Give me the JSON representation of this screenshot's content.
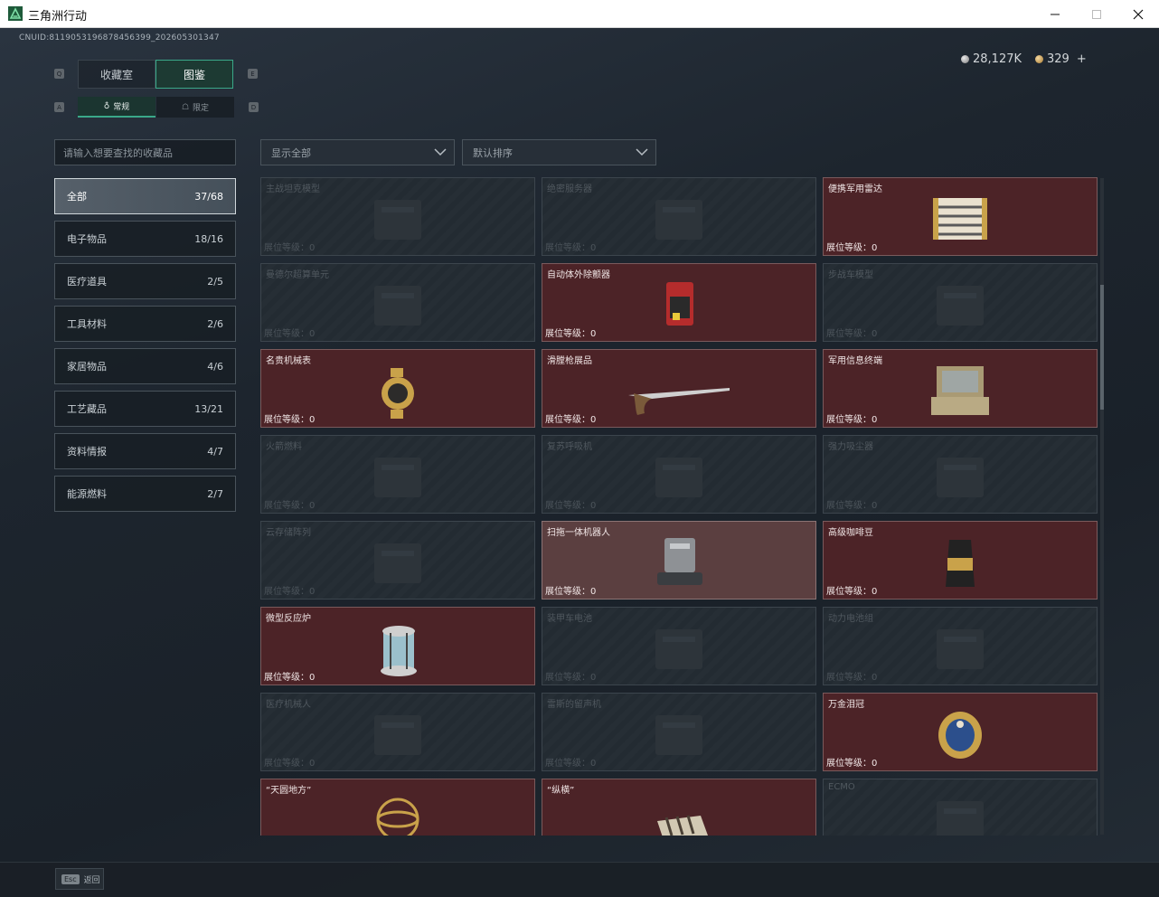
{
  "window": {
    "title": "三角洲行动"
  },
  "header": {
    "uid": "CNUID:8119053196878456399_202605301347",
    "currency_silver": "28,127K",
    "currency_gold": "329",
    "plus": "+"
  },
  "tabs": {
    "main": [
      {
        "label": "收藏室"
      },
      {
        "label": "图鉴"
      }
    ],
    "sub": [
      {
        "label": "常规"
      },
      {
        "label": "限定"
      }
    ],
    "keys": {
      "q": "Q",
      "e": "E",
      "a": "A",
      "d": "D"
    }
  },
  "search": {
    "placeholder": "请输入想要查找的收藏品"
  },
  "categories": [
    {
      "label": "全部",
      "count": "37/68"
    },
    {
      "label": "电子物品",
      "count": "18/16"
    },
    {
      "label": "医疗道具",
      "count": "2/5"
    },
    {
      "label": "工具材料",
      "count": "2/6"
    },
    {
      "label": "家居物品",
      "count": "4/6"
    },
    {
      "label": "工艺藏品",
      "count": "13/21"
    },
    {
      "label": "资料情报",
      "count": "4/7"
    },
    {
      "label": "能源燃料",
      "count": "2/7"
    }
  ],
  "filters": {
    "filter": "显示全部",
    "sort": "默认排序"
  },
  "items": [
    {
      "name": "主战坦克模型",
      "level": "展位等级：0",
      "state": "locked",
      "icon": "tank-model-icon"
    },
    {
      "name": "绝密服务器",
      "level": "展位等级：0",
      "state": "locked",
      "icon": "server-icon"
    },
    {
      "name": "便携军用雷达",
      "level": "展位等级：0",
      "state": "owned",
      "icon": "radar-icon"
    },
    {
      "name": "曼德尔超算单元",
      "level": "展位等级：0",
      "state": "locked",
      "icon": "supercomputer-icon"
    },
    {
      "name": "自动体外除颤器",
      "level": "展位等级：0",
      "state": "owned",
      "icon": "defibrillator-icon"
    },
    {
      "name": "步战车模型",
      "level": "展位等级：0",
      "state": "locked",
      "icon": "ifv-model-icon"
    },
    {
      "name": "名贵机械表",
      "level": "展位等级：0",
      "state": "owned",
      "icon": "watch-icon"
    },
    {
      "name": "滑膛枪展品",
      "level": "展位等级：0",
      "state": "owned",
      "icon": "musket-icon"
    },
    {
      "name": "军用信息终端",
      "level": "展位等级：0",
      "state": "owned",
      "icon": "terminal-icon"
    },
    {
      "name": "火箭燃料",
      "level": "展位等级：0",
      "state": "locked",
      "icon": "rocket-fuel-icon"
    },
    {
      "name": "复苏呼吸机",
      "level": "展位等级：0",
      "state": "locked",
      "icon": "ventilator-icon"
    },
    {
      "name": "强力吸尘器",
      "level": "展位等级：0",
      "state": "locked",
      "icon": "vacuum-icon"
    },
    {
      "name": "云存储阵列",
      "level": "展位等级：0",
      "state": "locked",
      "icon": "storage-array-icon"
    },
    {
      "name": "扫拖一体机器人",
      "level": "展位等级：0",
      "state": "highlight",
      "icon": "robot-vacuum-icon"
    },
    {
      "name": "高级咖啡豆",
      "level": "展位等级：0",
      "state": "owned",
      "icon": "coffee-bag-icon"
    },
    {
      "name": "微型反应炉",
      "level": "展位等级：0",
      "state": "owned",
      "icon": "reactor-icon"
    },
    {
      "name": "装甲车电池",
      "level": "展位等级：0",
      "state": "locked",
      "icon": "battery-icon"
    },
    {
      "name": "动力电池组",
      "level": "展位等级：0",
      "state": "locked",
      "icon": "battery-pack-icon"
    },
    {
      "name": "医疗机械人",
      "level": "展位等级：0",
      "state": "locked",
      "icon": "medical-robot-icon"
    },
    {
      "name": "雷斯的留声机",
      "level": "展位等级：0",
      "state": "locked",
      "icon": "gramophone-icon"
    },
    {
      "name": "万金泪冠",
      "level": "展位等级：0",
      "state": "owned",
      "icon": "jeweled-egg-icon"
    },
    {
      "name": "“天圆地方”",
      "level": "",
      "state": "owned",
      "icon": "armillary-sphere-icon"
    },
    {
      "name": "“纵横”",
      "level": "",
      "state": "owned",
      "icon": "chessboard-icon"
    },
    {
      "name": "ECMO",
      "level": "",
      "state": "locked",
      "icon": "ecmo-icon"
    }
  ],
  "footer": {
    "esc_key": "Esc",
    "esc_label": "返回"
  },
  "colors": {
    "owned": "#4c2327",
    "accent": "#3aa889",
    "locked": "#232b32"
  }
}
